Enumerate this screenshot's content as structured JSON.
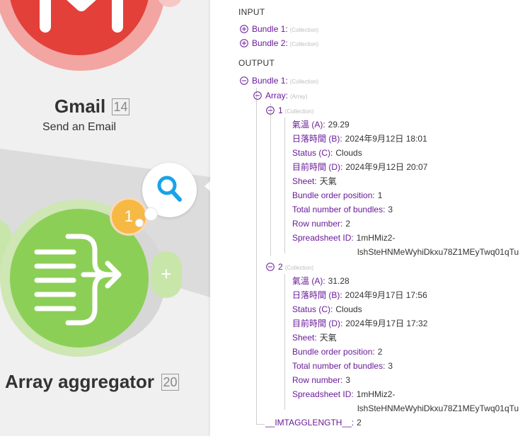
{
  "colors": {
    "gmail_red": "#e3403a",
    "aggregator_green": "#8ccf57",
    "ops_badge_orange": "#f6b944",
    "search_blue": "#1aa3e8",
    "key_purple": "#6a1b9a"
  },
  "canvas": {
    "gmail": {
      "title": "Gmail",
      "badge": "14",
      "subtitle": "Send an Email",
      "icon": "gmail-m-icon"
    },
    "aggregator": {
      "title": "Array aggregator",
      "badge": "20",
      "icon": "array-aggregator-icon"
    },
    "operations_badge": "1",
    "search_icon": "search-icon"
  },
  "inspector": {
    "input_label": "INPUT",
    "input_bundles": [
      {
        "key": "Bundle 1:",
        "type": "(Collection)"
      },
      {
        "key": "Bundle 2:",
        "type": "(Collection)"
      }
    ],
    "output_label": "OUTPUT",
    "output_bundle": {
      "key": "Bundle 1:",
      "type": "(Collection)"
    },
    "array": {
      "key": "Array:",
      "type": "(Array)"
    },
    "items": [
      {
        "key": "1",
        "type": "(Collection)",
        "fields": [
          {
            "key": "氣溫 (A):",
            "value": "29.29"
          },
          {
            "key": "日落時間 (B):",
            "value": "2024年9月12日 18:01"
          },
          {
            "key": "Status (C):",
            "value": "Clouds"
          },
          {
            "key": "目前時間 (D):",
            "value": "2024年9月12日 20:07"
          },
          {
            "key": "Sheet:",
            "value": "天氣"
          },
          {
            "key": "Bundle order position:",
            "value": "1"
          },
          {
            "key": "Total number of bundles:",
            "value": "3"
          },
          {
            "key": "Row number:",
            "value": "2"
          },
          {
            "key": "Spreadsheet ID:",
            "value": "1mHMiz2-",
            "value_cont": "lshSteHNMeWyhiDkxu78Z1MEyTwq01qTu"
          }
        ]
      },
      {
        "key": "2",
        "type": "(Collection)",
        "fields": [
          {
            "key": "氣溫 (A):",
            "value": "31.28"
          },
          {
            "key": "日落時間 (B):",
            "value": "2024年9月17日 17:56"
          },
          {
            "key": "Status (C):",
            "value": "Clouds"
          },
          {
            "key": "目前時間 (D):",
            "value": "2024年9月17日 17:32"
          },
          {
            "key": "Sheet:",
            "value": "天氣"
          },
          {
            "key": "Bundle order position:",
            "value": "2"
          },
          {
            "key": "Total number of bundles:",
            "value": "3"
          },
          {
            "key": "Row number:",
            "value": "3"
          },
          {
            "key": "Spreadsheet ID:",
            "value": "1mHMiz2-",
            "value_cont": "lshSteHNMeWyhiDkxu78Z1MEyTwq01qTu"
          }
        ]
      }
    ],
    "imtag": {
      "key": "__IMTAGGLENGTH__:",
      "value": "2"
    }
  }
}
